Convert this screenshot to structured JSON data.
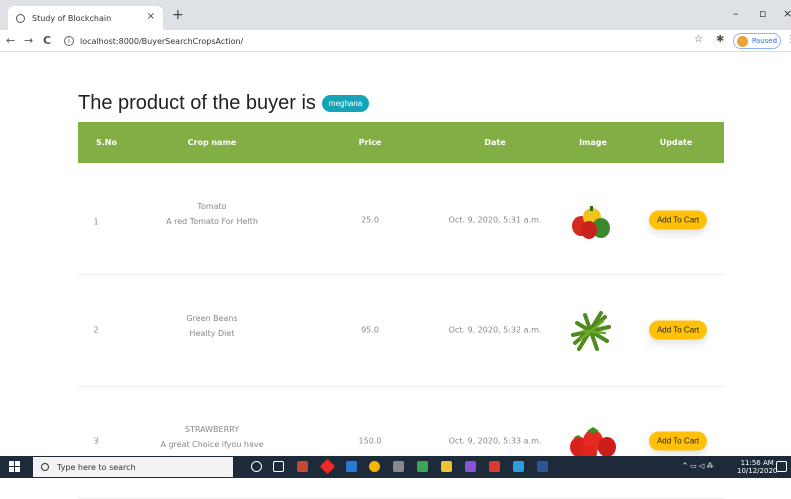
{
  "browser": {
    "tab_title": "Study of Blockchain",
    "tab_close": "×",
    "new_tab": "+",
    "minimize": "–",
    "restore": "▫",
    "close": "×",
    "back": "←",
    "forward": "→",
    "reload": "C",
    "url": "localhost:8000/BuyerSearchCropsAction/",
    "profile_status": "Paused"
  },
  "page": {
    "heading": "The product of the buyer is",
    "buyer_badge": "meghana"
  },
  "table": {
    "headers": [
      "S.No",
      "Crop name",
      "Price",
      "Date",
      "Image",
      "Update"
    ],
    "rows": [
      {
        "sno": "1",
        "crop": "Tomato",
        "desc": "A red Tomato For Helth",
        "price": "25.0",
        "date": "Oct. 9, 2020, 5:31 a.m.",
        "image": "bell-peppers-image",
        "action": "Add To Cart"
      },
      {
        "sno": "2",
        "crop": "Green Beans",
        "desc": "Healty Diet",
        "price": "95.0",
        "date": "Oct. 9, 2020, 5:32 a.m.",
        "image": "green-beans-image",
        "action": "Add To Cart"
      },
      {
        "sno": "3",
        "crop": "STRAWBERRY",
        "desc": "A great Choice ifyou have",
        "price": "150.0",
        "date": "Oct. 9, 2020, 5:33 a.m.",
        "image": "strawberries-image",
        "action": "Add To Cart"
      }
    ]
  },
  "taskbar": {
    "search_placeholder": "Type here to search",
    "time": "11:56 AM",
    "date": "10/12/2020"
  },
  "colors": {
    "table_header": "#82ae46",
    "badge": "#17a2b8",
    "cart_button": "#ffc107"
  }
}
